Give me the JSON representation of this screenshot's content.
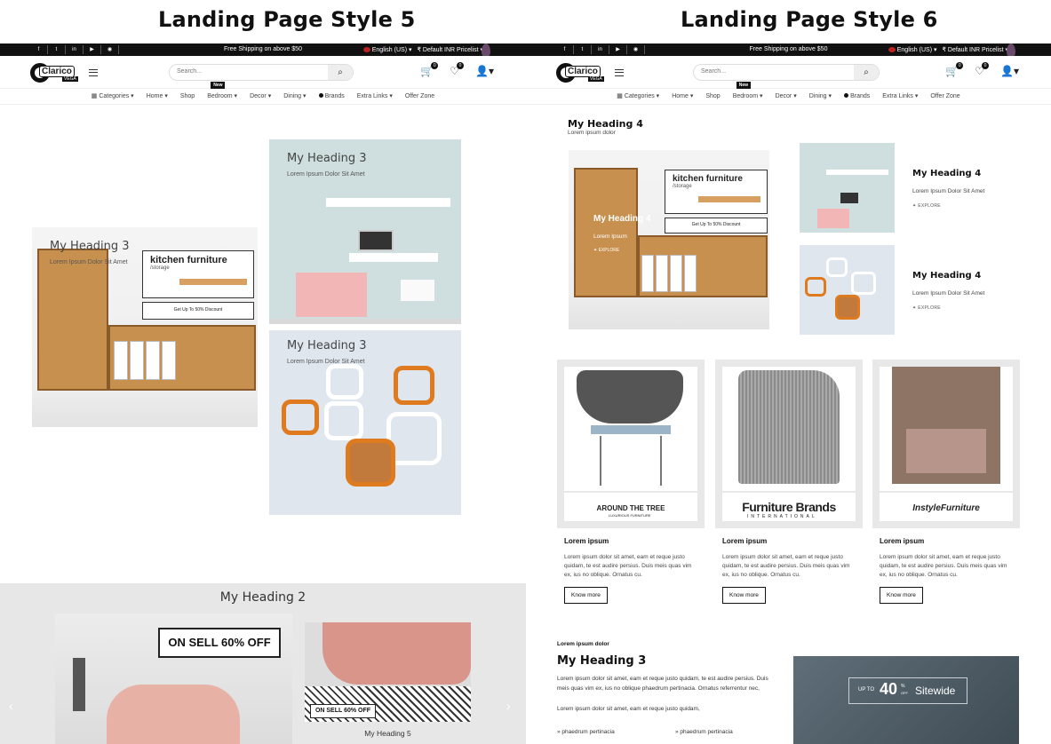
{
  "titles": {
    "left": "Landing Page Style 5",
    "right": "Landing Page Style 6"
  },
  "topbar": {
    "shipping": "Free Shipping on above $50",
    "language": "English (US)",
    "pricelist": "₹ Default INR Pricelist",
    "social_icons": [
      "facebook-icon",
      "twitter-icon",
      "linkedin-icon",
      "youtube-icon",
      "github-icon"
    ]
  },
  "header": {
    "logo_text": "Clarico",
    "logo_sub": "VEGA",
    "search_placeholder": "Search...",
    "cart_count": "0",
    "wishlist_count": "0"
  },
  "nav": {
    "items": [
      "Categories",
      "Home",
      "Shop",
      "Bedroom",
      "Decor",
      "Dining",
      "Brands",
      "Extra Links",
      "Offer Zone"
    ],
    "new_tag": "New"
  },
  "style5": {
    "tile1": {
      "heading": "My Heading 3",
      "sub": "Lorem Ipsum Dolor Sit Amet",
      "box_title": "kitchen furniture",
      "box_sub": "/storage",
      "discount": "Get Up To 50% Discount"
    },
    "tile2": {
      "heading": "My Heading 3",
      "sub": "Lorem Ipsum Dolor Sit Amet"
    },
    "tile3": {
      "heading": "My Heading 3",
      "sub": "Lorem Ipsum Dolor Sit Amet"
    },
    "section2": {
      "heading": "My Heading 2",
      "sale_big": "ON SELL 60% OFF",
      "sale_small": "ON SELL 60% OFF",
      "caption": "My Heading 5"
    }
  },
  "style6": {
    "intro": {
      "heading": "My Heading 4",
      "sub": "Lorem ipsum dolor"
    },
    "big_tile": {
      "box_title": "kitchen furniture",
      "box_sub": "/storage",
      "discount": "Get Up To 50% Discount",
      "heading": "My Heading 4",
      "sub": "Lorem Ipsum",
      "explore": "EXPLORE"
    },
    "side1": {
      "heading": "My Heading 4",
      "sub": "Lorem Ipsum Dolor Sit Amet",
      "explore": "EXPLORE"
    },
    "side2": {
      "heading": "My Heading 4",
      "sub": "Lorem Ipsum Dolor Sit Amet",
      "explore": "EXPLORE"
    },
    "cards": [
      {
        "brand": "AROUND THE TREE",
        "brand_sub": "LUXURIOUS FURNITURE",
        "title": "Lorem ipsum",
        "text": "Lorem ipsum dolor sit amet, eam et reque justo quidam, te est audire persius. Duis meis quas vim ex, ius no oblique. Ornatus cu.",
        "button": "Know more"
      },
      {
        "brand": "Furniture Brands",
        "brand_sub": "INTERNATIONAL",
        "title": "Lorem ipsum",
        "text": "Lorem ipsum dolor sit amet, eam et reque justo quidam, te est audire persius. Duis meis quas vim ex, ius no oblique. Ornatus cu.",
        "button": "Know more"
      },
      {
        "brand": "InstyleFurniture",
        "brand_sub": "",
        "title": "Lorem ipsum",
        "text": "Lorem ipsum dolor sit amet, eam et reque justo quidam, te est audire persius. Duis meis quas vim ex, ius no oblique. Ornatus cu.",
        "button": "Know more"
      }
    ],
    "section3": {
      "label": "Lorem ipsum dolor",
      "heading": "My Heading 3",
      "p1": "Lorem ipsum dolor sit amet, eam et reque justo quidam, te est audire persius. Duis meis quas vim ex, ius no oblique phaedrum pertinacia. Ornatus referrentur nec,",
      "p2": "Lorem ipsum dolor sit amet, eam et reque justo quidam,",
      "link1": "phaedrum pertinacia",
      "link2": "phaedrum pertinacia",
      "promo_up": "UP TO",
      "promo_num": "40",
      "promo_pct": "%",
      "promo_off": "OFF",
      "promo_text": "Sitewide"
    }
  }
}
